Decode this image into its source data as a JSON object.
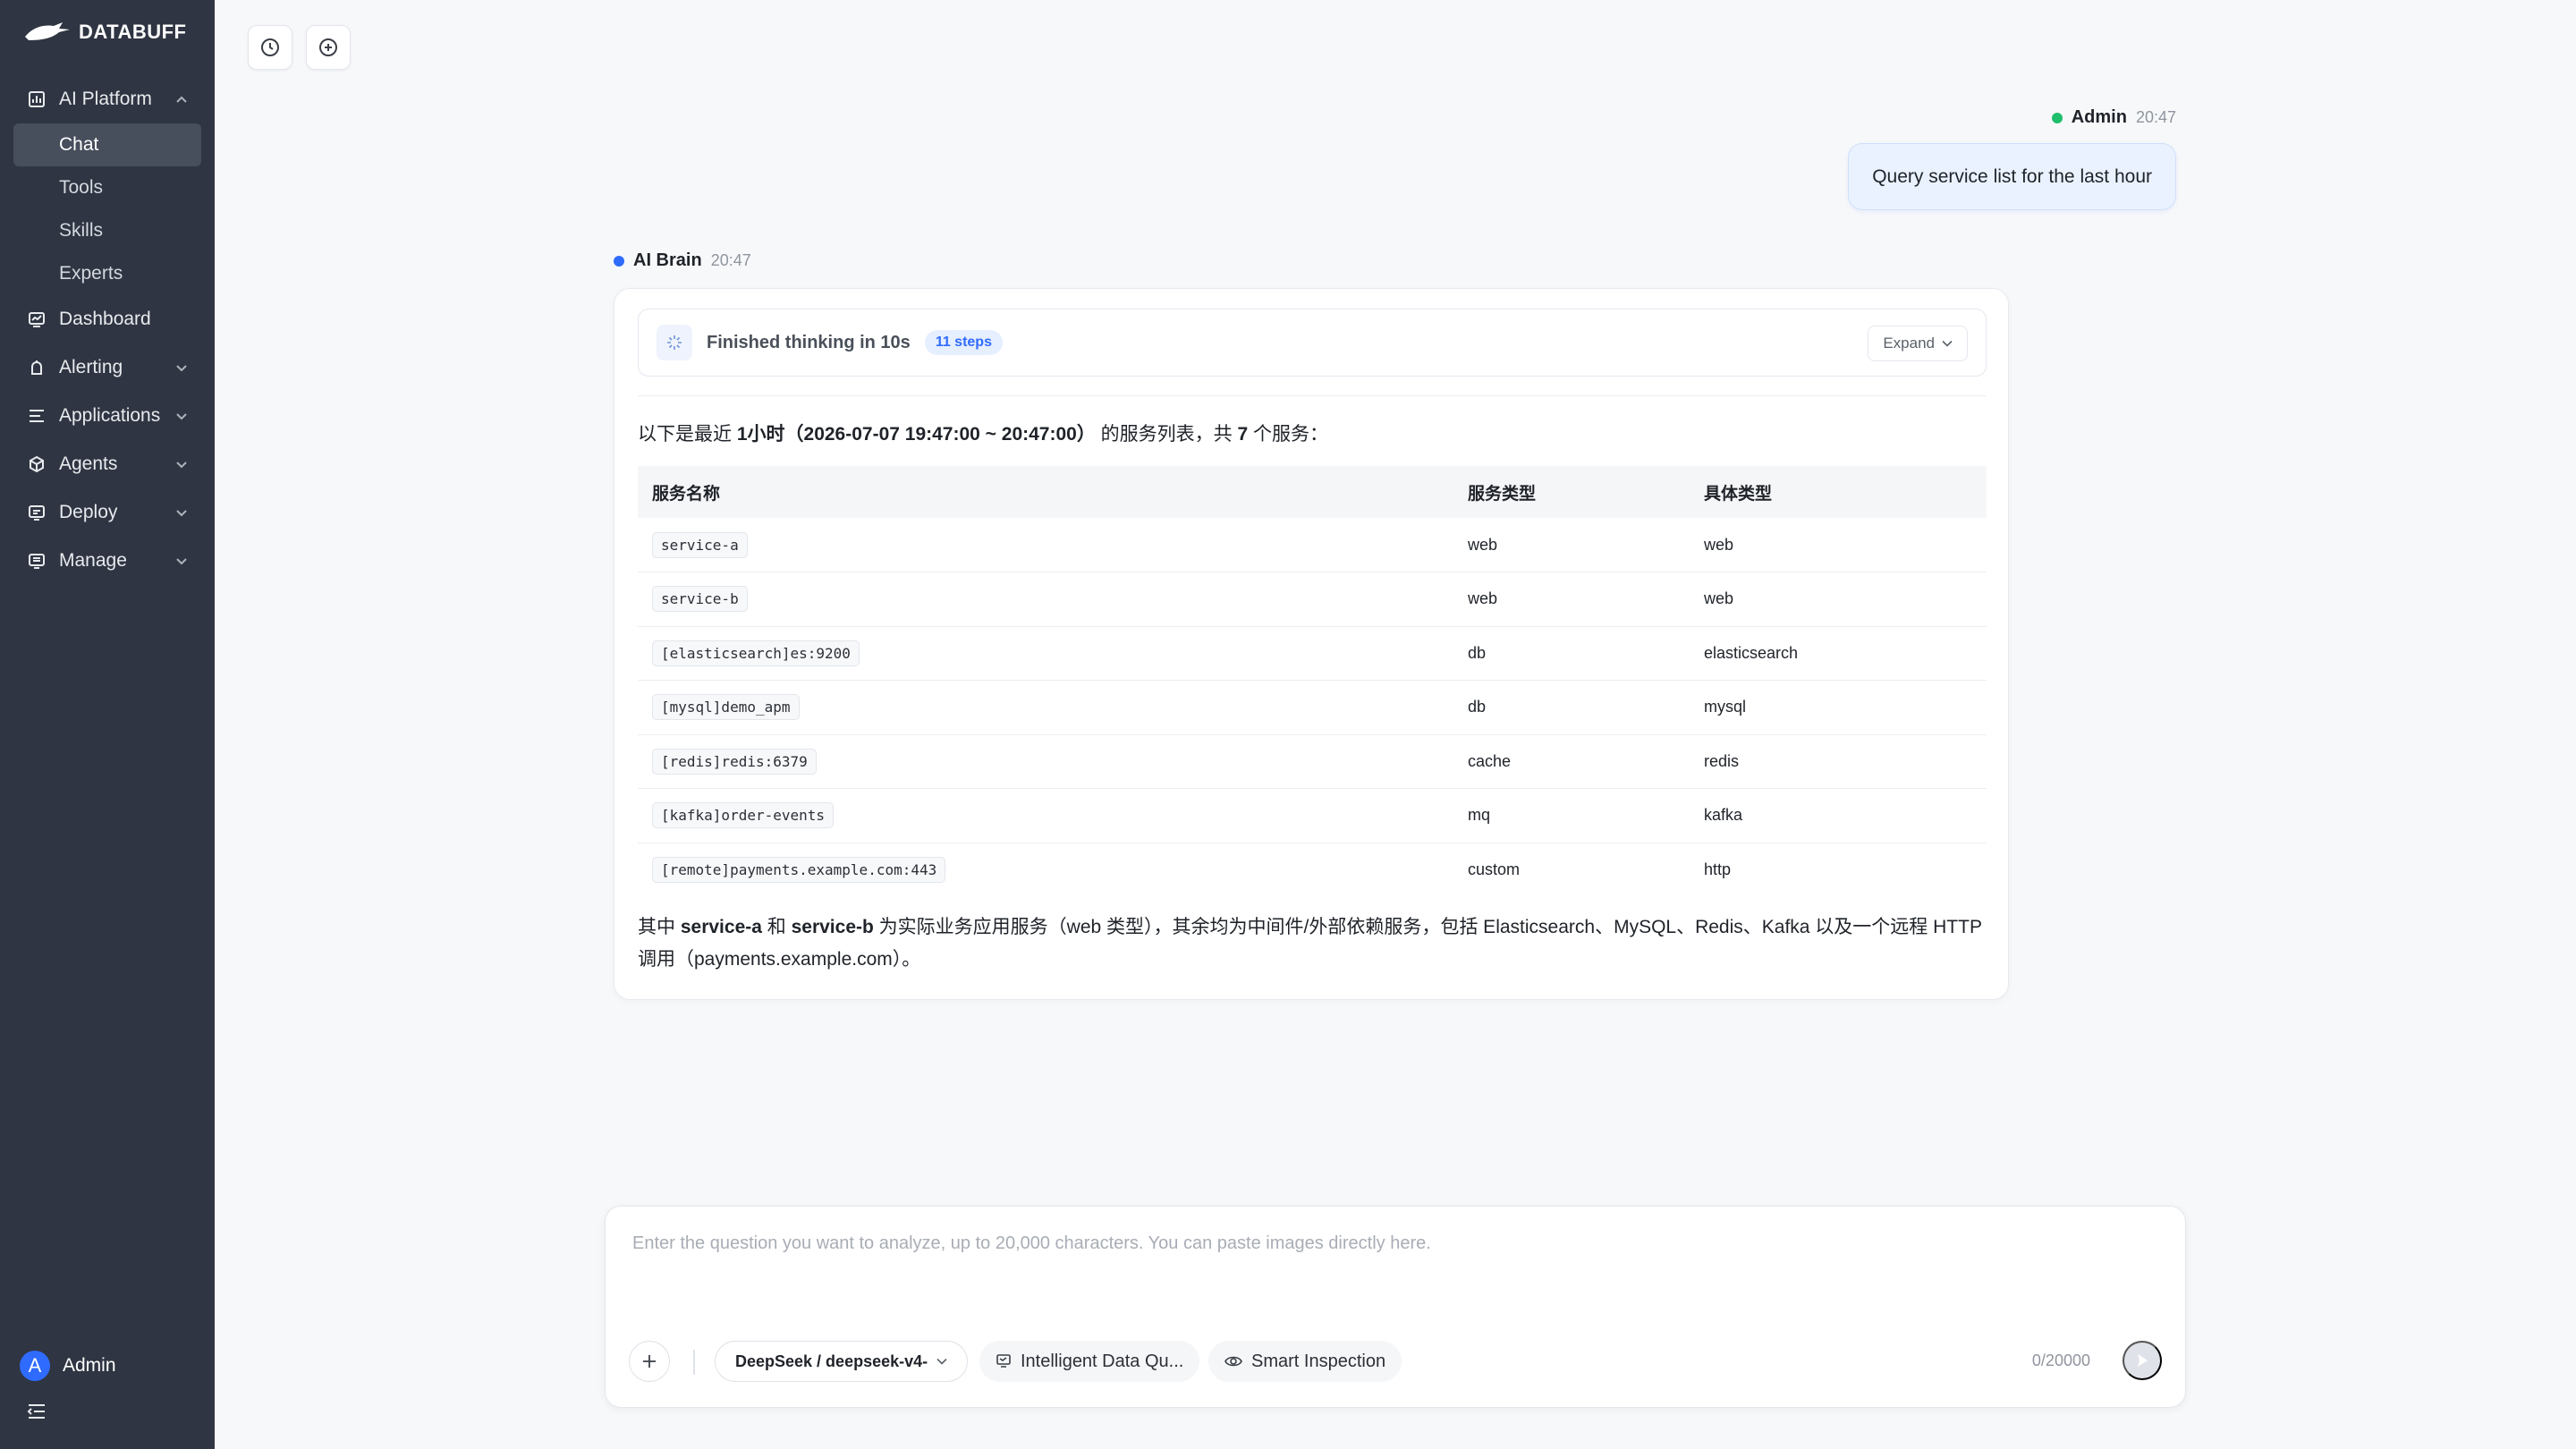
{
  "brand": {
    "name": "DATABUFF"
  },
  "sidebar": {
    "groups": [
      {
        "label": "AI Platform",
        "icon": "chart-icon",
        "expanded": true,
        "items": [
          {
            "label": "Chat",
            "active": true
          },
          {
            "label": "Tools"
          },
          {
            "label": "Skills"
          },
          {
            "label": "Experts"
          }
        ]
      },
      {
        "label": "Dashboard",
        "icon": "dashboard-icon"
      },
      {
        "label": "Alerting",
        "icon": "alert-icon"
      },
      {
        "label": "Applications",
        "icon": "applications-icon"
      },
      {
        "label": "Agents",
        "icon": "agents-icon"
      },
      {
        "label": "Deploy",
        "icon": "deploy-icon"
      },
      {
        "label": "Manage",
        "icon": "manage-icon"
      }
    ],
    "user": {
      "initial": "A",
      "name": "Admin"
    }
  },
  "toolbar": {
    "history_icon": "history-icon",
    "new_chat_icon": "new-chat-icon"
  },
  "conversation": {
    "user_message": {
      "author": "Admin",
      "time": "20:47",
      "text": "Query service list for the last hour",
      "status_color": "#1fbf6b"
    },
    "ai_message": {
      "author": "AI Brain",
      "time": "20:47",
      "status_color": "#2f6bff",
      "thinking": {
        "label": "Finished thinking in 10s",
        "steps": "11 steps",
        "expand_label": "Expand"
      },
      "intro": {
        "prefix": "以下是最近 ",
        "range": "1小时（2026-07-07 19:47:00 ~ 20:47:00）",
        "middle": " 的服务列表，共 ",
        "count": "7",
        "suffix": " 个服务："
      },
      "table": {
        "headers": [
          "服务名称",
          "服务类型",
          "具体类型"
        ],
        "rows": [
          [
            "service-a",
            "web",
            "web"
          ],
          [
            "service-b",
            "web",
            "web"
          ],
          [
            "[elasticsearch]es:9200",
            "db",
            "elasticsearch"
          ],
          [
            "[mysql]demo_apm",
            "db",
            "mysql"
          ],
          [
            "[redis]redis:6379",
            "cache",
            "redis"
          ],
          [
            "[kafka]order-events",
            "mq",
            "kafka"
          ],
          [
            "[remote]payments.example.com:443",
            "custom",
            "http"
          ]
        ]
      },
      "summary": {
        "p1": "其中 ",
        "svc_a": "service-a",
        "p2": " 和 ",
        "svc_b": "service-b",
        "p3": " 为实际业务应用服务（web 类型），其余均为中间件/外部依赖服务，包括 Elasticsearch、MySQL、Redis、Kafka 以及一个远程 HTTP 调用（payments.example.com）。"
      }
    }
  },
  "composer": {
    "placeholder": "Enter the question you want to analyze, up to 20,000 characters. You can paste images directly here.",
    "model": "DeepSeek / deepseek-v4-",
    "mode_1": "Intelligent Data Qu...",
    "mode_2": "Smart Inspection",
    "char_count": "0/20000"
  },
  "colors": {
    "sidebar_bg": "#2f3542",
    "accent": "#2f6bff",
    "online": "#1fbf6b"
  }
}
